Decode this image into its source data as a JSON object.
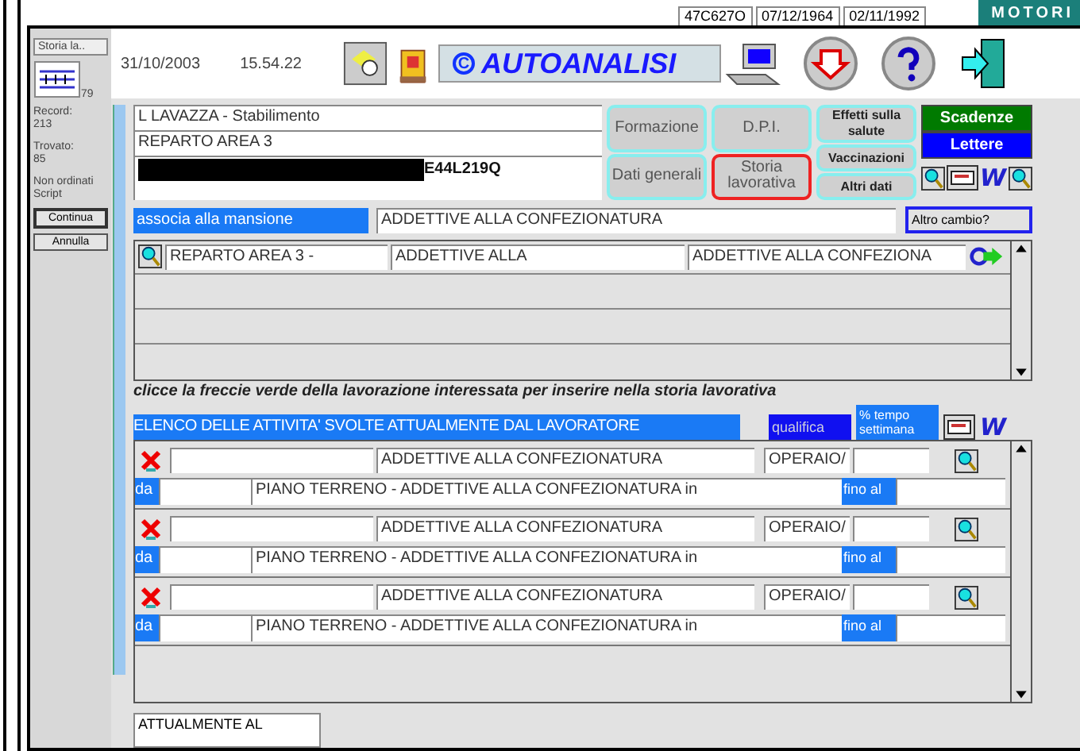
{
  "background_window": {
    "cells": [
      "47C627O",
      "07/12/1964",
      "02/11/1992"
    ],
    "banner": "MOTORI"
  },
  "toolbar": {
    "date": "31/10/2003",
    "time": "15.54.22",
    "logo_mark": "C",
    "logo": "AUTOANALISI"
  },
  "sidebar": {
    "layout_menu": "Storia la..",
    "book_page": "79",
    "record_label": "Record:",
    "record": "213",
    "found_label": "Trovato:",
    "found": "85",
    "sort_status": "Non ordinati",
    "mode": "Script",
    "buttons": [
      "Continua",
      "Annulla"
    ]
  },
  "header": {
    "company": "L LAVAZZA - Stabilimento",
    "department": "REPARTO AREA 3",
    "fiscal_code": "E44L219Q"
  },
  "tab_columns": [
    [
      {
        "label": "Formazione",
        "selected": false
      },
      {
        "label": "Dati generali",
        "selected": false
      }
    ],
    [
      {
        "label": "D.P.I.",
        "selected": false
      },
      {
        "label": "Storia lavorativa",
        "selected": true
      }
    ],
    [
      {
        "label": "Effetti sulla salute",
        "selected": false
      },
      {
        "label": "Vaccinazioni",
        "selected": false
      },
      {
        "label": "Altri dati",
        "selected": false
      }
    ]
  ],
  "side_buttons": [
    {
      "label": "Scadenze",
      "color": "#007a00"
    },
    {
      "label": "Lettere",
      "color": "#0000ff"
    }
  ],
  "word_icon": "W",
  "assign": {
    "label": "associa alla mansione",
    "value": "ADDETTIVE ALLA CONFEZIONATURA",
    "button": "Altro cambio?"
  },
  "job_list": {
    "rows": [
      {
        "department": "REPARTO AREA 3 -",
        "task": "ADDETTIVE ALLA",
        "job": "ADDETTIVE ALLA CONFEZIONA"
      }
    ]
  },
  "instruction": "clicce la freccie verde della lavorazione interessata per inserire nella storia lavorativa",
  "activities": {
    "title": "ELENCO DELLE ATTIVITA' SVOLTE ATTUALMENTE DAL LAVORATORE",
    "qualifica": "qualifica",
    "time_header": "% tempo settimana",
    "word_icon": "W",
    "rows": [
      {
        "task": "ADDETTIVE ALLA CONFEZIONATURA",
        "qualifica": "OPERAIO/",
        "from_label": "da",
        "location": "PIANO TERRENO - ADDETTIVE ALLA CONFEZIONATURA in",
        "to_label": "fino al"
      },
      {
        "task": "ADDETTIVE ALLA CONFEZIONATURA",
        "qualifica": "OPERAIO/",
        "from_label": "da",
        "location": "PIANO TERRENO - ADDETTIVE ALLA CONFEZIONATURA in",
        "to_label": "fino al"
      },
      {
        "task": "ADDETTIVE ALLA CONFEZIONATURA",
        "qualifica": "OPERAIO/",
        "from_label": "da",
        "location": "PIANO TERRENO - ADDETTIVE ALLA CONFEZIONATURA in",
        "to_label": "fino al"
      }
    ]
  },
  "footer": {
    "status": "ATTUALMENTE AL"
  }
}
